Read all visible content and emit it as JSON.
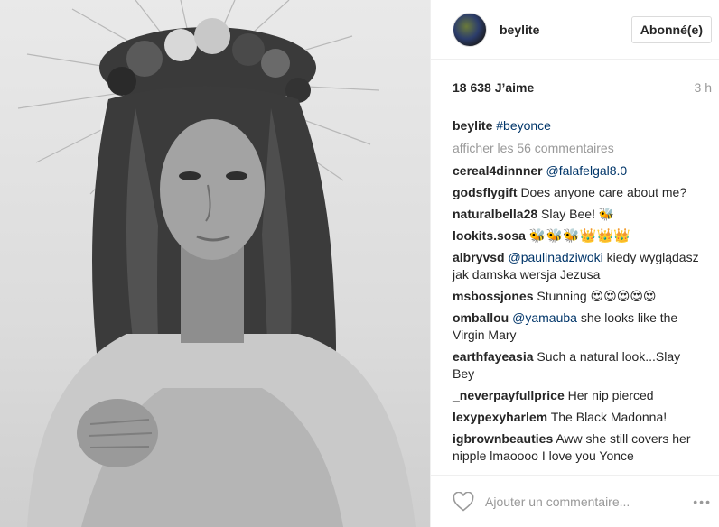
{
  "header": {
    "username": "beylite",
    "follow_label": "Abonné(e)"
  },
  "meta": {
    "likes": "18 638 J’aime",
    "time": "3 h"
  },
  "caption": {
    "user": "beylite",
    "tag": "#beyonce"
  },
  "view_more": "afficher les 56 commentaires",
  "comments": [
    {
      "user": "cereal4dinnner",
      "mention": "@falafelgal8.0",
      "text": ""
    },
    {
      "user": "godsflygift",
      "mention": "",
      "text": "Does anyone care about me?"
    },
    {
      "user": "naturalbella28",
      "mention": "",
      "text": "Slay Bee! 🐝"
    },
    {
      "user": "lookits.sosa",
      "mention": "",
      "text": "🐝🐝🐝👑👑👑"
    },
    {
      "user": "albryvsd",
      "mention": "@paulinadziwoki",
      "text": "kiedy wyglądasz jak damska wersja Jezusa"
    },
    {
      "user": "msbossjones",
      "mention": "",
      "text": "Stunning 😍😍😍😍😍"
    },
    {
      "user": "omballou",
      "mention": "@yamauba",
      "text": "she looks like the Virgin Mary"
    },
    {
      "user": "earthfayeasia",
      "mention": "",
      "text": "Such a natural look...Slay Bey"
    },
    {
      "user": "_neverpayfullprice",
      "mention": "",
      "text": "Her nip pierced"
    },
    {
      "user": "lexypexyharlem",
      "mention": "",
      "text": "The Black Madonna!"
    },
    {
      "user": "igbrownbeauties",
      "mention": "",
      "text": "Aww she still covers her nipple lmaoooo I love you Yonce"
    }
  ],
  "footer": {
    "placeholder": "Ajouter un commentaire...",
    "more_icon": "•••"
  },
  "icons": {
    "heart": "heart-icon",
    "more": "more-options-icon"
  },
  "colors": {
    "link": "#003569",
    "muted": "#999999",
    "text": "#262626",
    "border": "#efefef"
  }
}
